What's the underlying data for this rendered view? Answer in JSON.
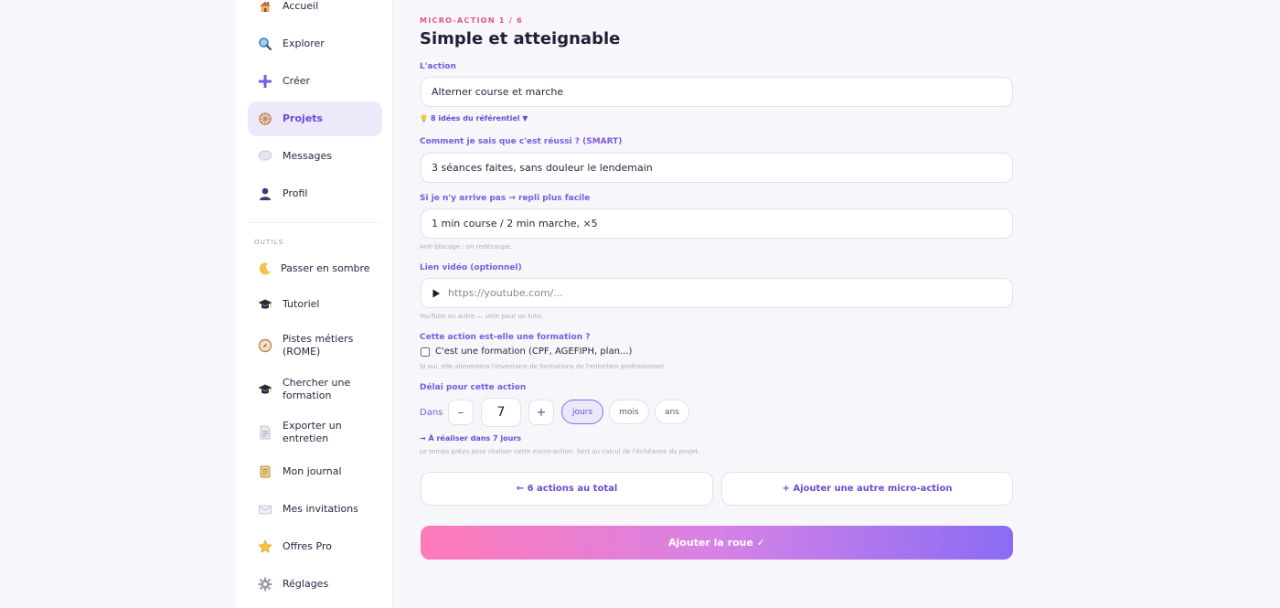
{
  "sidebar": {
    "items": [
      {
        "label": "Accueil",
        "icon": "house-icon"
      },
      {
        "label": "Explorer",
        "icon": "magnifier-icon"
      },
      {
        "label": "Créer",
        "icon": "plus-icon"
      },
      {
        "label": "Projets",
        "icon": "wheel-icon"
      },
      {
        "label": "Messages",
        "icon": "speech-bubble-icon"
      },
      {
        "label": "Profil",
        "icon": "person-icon"
      }
    ],
    "tools_title": "OUTILS",
    "tools": [
      {
        "label": "Passer en sombre",
        "icon": "moon-icon"
      },
      {
        "label": "Tutoriel",
        "icon": "graduation-cap-icon"
      },
      {
        "label": "Pistes métiers (ROME)",
        "icon": "compass-icon"
      },
      {
        "label": "Chercher une formation",
        "icon": "graduation-cap-icon"
      },
      {
        "label": "Exporter un entretien",
        "icon": "document-icon"
      },
      {
        "label": "Mon journal",
        "icon": "scroll-icon"
      },
      {
        "label": "Mes invitations",
        "icon": "envelope-icon"
      },
      {
        "label": "Offres Pro",
        "icon": "star-icon"
      },
      {
        "label": "Réglages",
        "icon": "gear-icon"
      }
    ],
    "active_index": 3
  },
  "form": {
    "eyebrow": "MICRO-ACTION 1 / 6",
    "title": "Simple et atteignable",
    "action_label": "L'action",
    "action_value": "Alterner course et marche",
    "ideas_link": "8 idées du référentiel ▼",
    "smart_label": "Comment je sais que c'est réussi ? (SMART)",
    "smart_value": "3 séances faites, sans douleur le lendemain",
    "fallback_label": "Si je n'y arrive pas → repli plus facile",
    "fallback_value": "1 min course / 2 min marche, ×5",
    "fallback_hint": "Anti-blocage : on redécoupe.",
    "video_label": "Lien vidéo (optionnel)",
    "video_placeholder": "https://youtube.com/...",
    "video_hint": "YouTube ou autre — utile pour un tuto.",
    "training_label": "Cette action est-elle une formation ?",
    "training_checkbox": "C'est une formation (CPF, AGEFIPH, plan...)",
    "training_checked": false,
    "training_hint": "Si oui, elle alimentera l'inventaire de formations de l'entretien professionnel.",
    "delay_label": "Délai pour cette action",
    "delay_prefix": "Dans",
    "minus": "–",
    "plus": "+",
    "delay_value": "7",
    "units": [
      "jours",
      "mois",
      "ans"
    ],
    "unit_selected": "jours",
    "realise_text": "→ À réaliser dans 7 jours",
    "realise_hint": "Le temps prévu pour réaliser cette micro-action. Sert au calcul de l'échéance du projet.",
    "total_button": "← 6 actions au total",
    "add_button": "+  Ajouter une autre micro-action",
    "submit_button": "Ajouter la roue ✓"
  },
  "colors": {
    "accent": "#6a4bd8",
    "eyebrow": "#e5508f",
    "gradient_start": "#ff7ab8",
    "gradient_end": "#8a6cf4"
  }
}
